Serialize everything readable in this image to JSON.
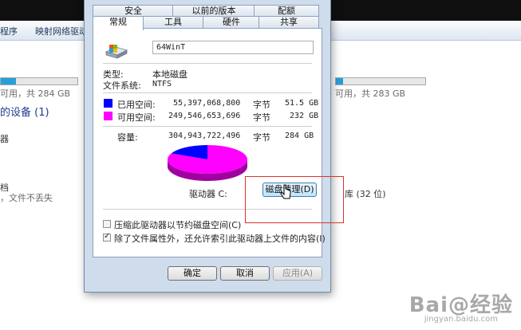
{
  "background": {
    "toolbar": {
      "items": [
        "程序",
        "映射网络驱动"
      ]
    },
    "drive_c_free": "可用，共 284 GB",
    "drive_d_free": "可用，共 283 GB",
    "section_devices": "的设备 (1)",
    "device_label": "器",
    "library_label": "档",
    "library_desc": "，文件不丢失",
    "library_right": "库 (32 位)",
    "watermark": {
      "brand": "Bai@经验",
      "url": "jingyan.baidu.com"
    }
  },
  "dialog": {
    "tabs_top": [
      "安全",
      "以前的版本",
      "配额"
    ],
    "tabs_bottom": [
      "常规",
      "工具",
      "硬件",
      "共享"
    ],
    "active_tab": "常规",
    "volume_name": "64WinT",
    "type_label": "类型:",
    "type_value": "本地磁盘",
    "fs_label": "文件系统:",
    "fs_value": "NTFS",
    "used": {
      "label": "已用空间:",
      "bytes": "55,397,068,800",
      "unit": "字节",
      "size": "51.5 GB",
      "color": "#0000ff"
    },
    "free": {
      "label": "可用空间:",
      "bytes": "249,546,653,696",
      "unit": "字节",
      "size": "232 GB",
      "color": "#ff00ff"
    },
    "capacity": {
      "label": "容量:",
      "bytes": "304,943,722,496",
      "unit": "字节",
      "size": "284 GB"
    },
    "used_fraction": 0.18,
    "drive_label": "驱动器 C:",
    "cleanup_button": "磁盘清理(D)",
    "compress_option": "压缩此驱动器以节约磁盘空间(C)",
    "compress_checked": false,
    "index_option": "除了文件属性外，还允许索引此驱动器上文件的内容(I)",
    "index_checked": true,
    "ok_button": "确定",
    "cancel_button": "取消",
    "apply_button": "应用(A)"
  }
}
